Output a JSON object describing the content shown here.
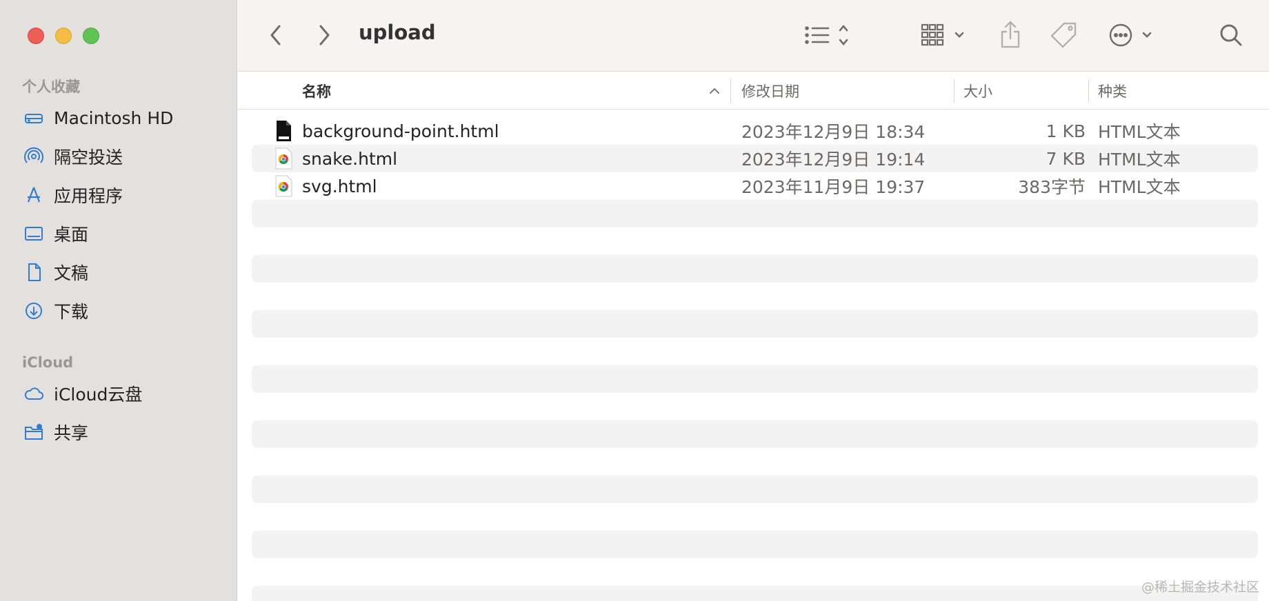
{
  "window": {
    "title": "upload"
  },
  "sidebar": {
    "favorites_title": "个人收藏",
    "favorites": [
      {
        "label": "Macintosh HD",
        "icon": "disk-icon"
      },
      {
        "label": "隔空投送",
        "icon": "airdrop-icon"
      },
      {
        "label": "应用程序",
        "icon": "applications-icon"
      },
      {
        "label": "桌面",
        "icon": "desktop-icon"
      },
      {
        "label": "文稿",
        "icon": "document-icon"
      },
      {
        "label": "下载",
        "icon": "download-icon"
      }
    ],
    "icloud_title": "iCloud",
    "icloud": [
      {
        "label": "iCloud云盘",
        "icon": "cloud-icon"
      },
      {
        "label": "共享",
        "icon": "shared-folder-icon"
      }
    ]
  },
  "columns": {
    "name": "名称",
    "date": "修改日期",
    "size": "大小",
    "kind": "种类"
  },
  "files": [
    {
      "name": "background-point.html",
      "date": "2023年12月9日 18:34",
      "size": "1 KB",
      "kind": "HTML文本",
      "icon": "html-file-icon"
    },
    {
      "name": "snake.html",
      "date": "2023年12月9日 19:14",
      "size": "7 KB",
      "kind": "HTML文本",
      "icon": "chrome-file-icon"
    },
    {
      "name": "svg.html",
      "date": "2023年11月9日 19:37",
      "size": "383字节",
      "kind": "HTML文本",
      "icon": "chrome-file-icon"
    }
  ],
  "watermark": "@稀土掘金技术社区",
  "colors": {
    "sidebar_bg": "#e3e0de",
    "toolbar_bg": "#f7f3f1",
    "stripe": "#f3f3f3",
    "accent_blue": "#2f7bd8"
  }
}
